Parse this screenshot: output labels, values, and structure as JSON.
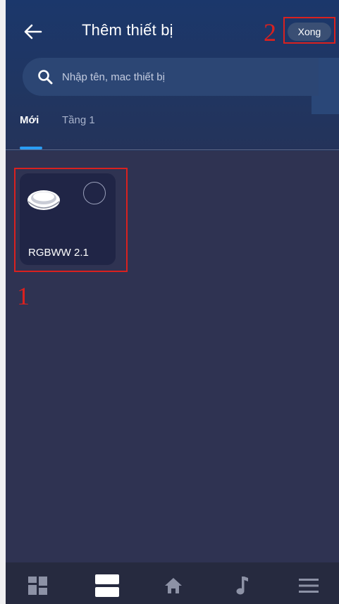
{
  "header": {
    "title": "Thêm thiết bị",
    "done_label": "Xong"
  },
  "search": {
    "placeholder": "Nhập tên, mac thiết bị"
  },
  "tabs": [
    {
      "label": "Mới",
      "active": true
    },
    {
      "label": "Tầng 1",
      "active": false
    }
  ],
  "devices": [
    {
      "name": "RGBWW 2.1",
      "icon": "ceiling-light-icon",
      "selected": false
    }
  ],
  "annotations": {
    "marker_1": "1",
    "marker_2": "2"
  },
  "bottom_nav": {
    "items": [
      {
        "icon": "dashboard-icon",
        "active": false
      },
      {
        "icon": "devices-icon",
        "active": true
      },
      {
        "icon": "home-icon",
        "active": false
      },
      {
        "icon": "music-icon",
        "active": false
      },
      {
        "icon": "menu-icon",
        "active": false
      }
    ]
  },
  "colors": {
    "background": "#2f3352",
    "header": "#1b376b",
    "accent": "#2a9df4",
    "annotation": "#d9211f",
    "card": "#202546"
  }
}
